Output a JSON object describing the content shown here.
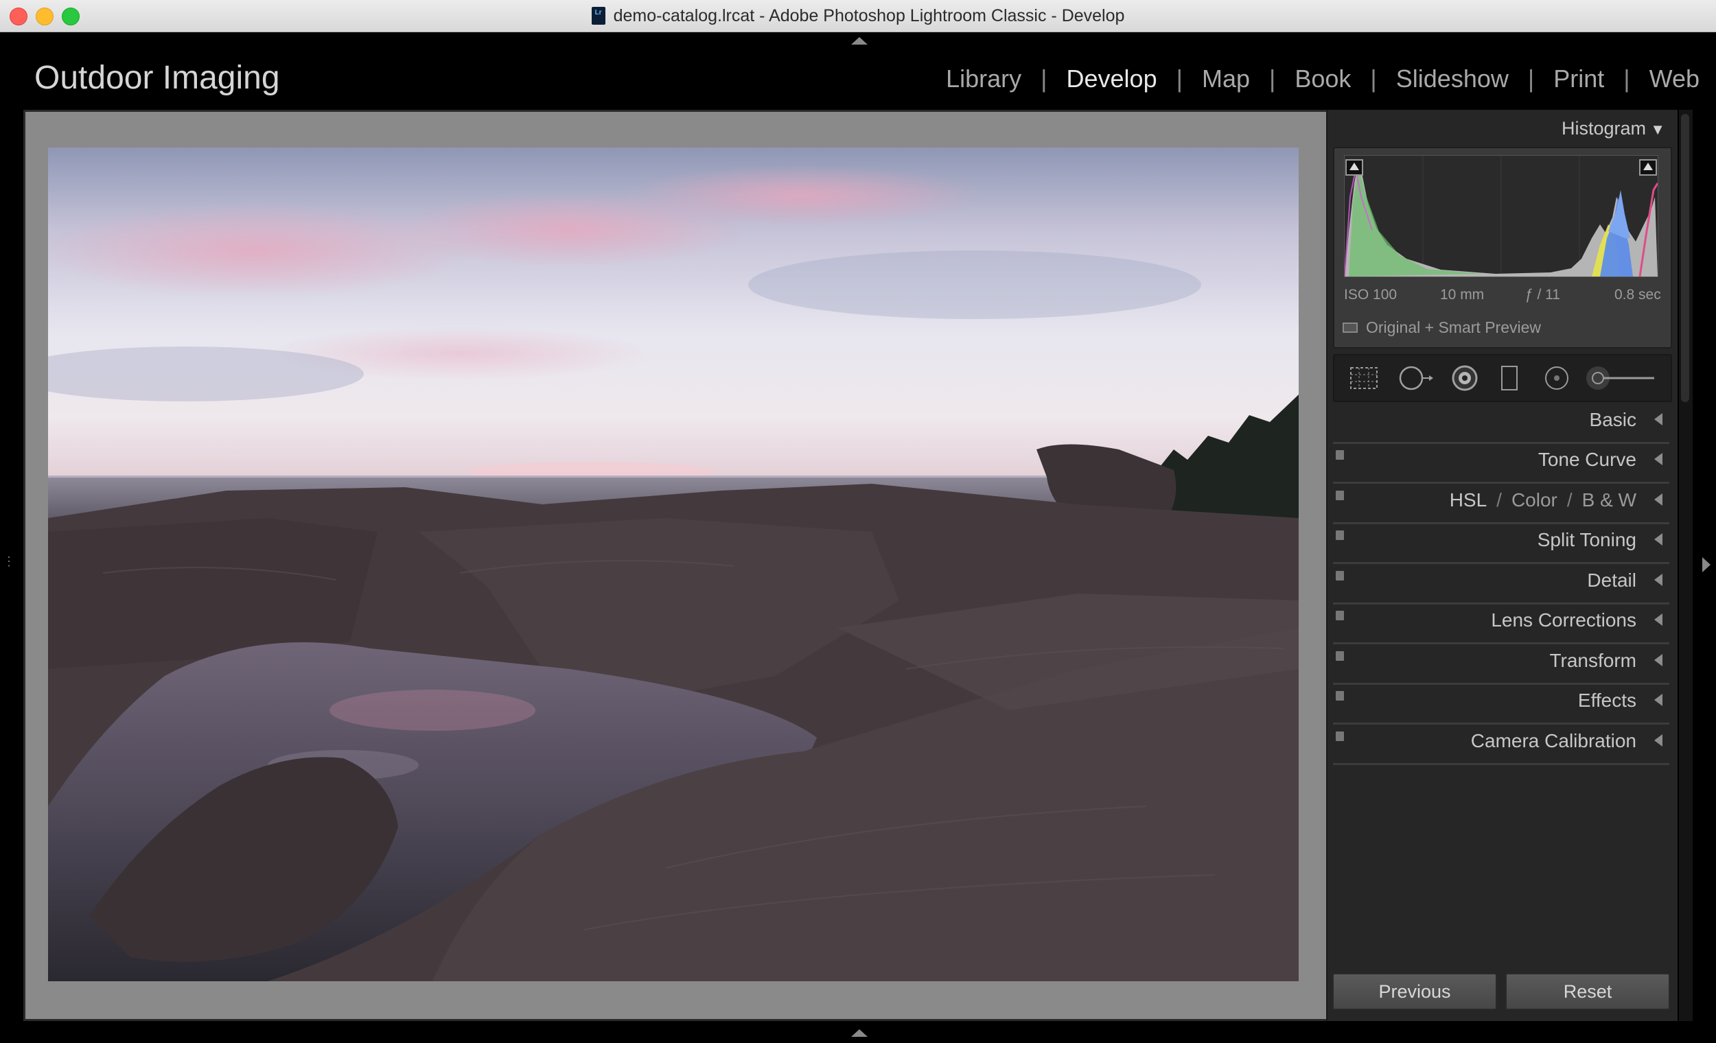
{
  "window": {
    "title": "demo-catalog.lrcat - Adobe Photoshop Lightroom Classic - Develop",
    "doc_icon_label": "Lr"
  },
  "identity_plate": "Outdoor Imaging",
  "modules": [
    {
      "label": "Library",
      "active": false
    },
    {
      "label": "Develop",
      "active": true
    },
    {
      "label": "Map",
      "active": false
    },
    {
      "label": "Book",
      "active": false
    },
    {
      "label": "Slideshow",
      "active": false
    },
    {
      "label": "Print",
      "active": false
    },
    {
      "label": "Web",
      "active": false
    }
  ],
  "module_separator": "|",
  "histogram": {
    "title": "Histogram",
    "iso": "ISO 100",
    "focal": "10 mm",
    "aperture": "ƒ / 11",
    "shutter": "0.8 sec",
    "preview_status": "Original + Smart Preview"
  },
  "tools": [
    "crop-overlay-icon",
    "spot-removal-icon",
    "red-eye-icon",
    "graduated-filter-icon",
    "radial-filter-icon",
    "adjustment-brush-icon"
  ],
  "sections": [
    {
      "label": "Basic",
      "has_toggle": false
    },
    {
      "label": "Tone Curve",
      "has_toggle": true
    },
    {
      "label": "HSL",
      "has_toggle": true
    },
    {
      "label": "Split Toning",
      "has_toggle": true
    },
    {
      "label": "Detail",
      "has_toggle": true
    },
    {
      "label": "Lens Corrections",
      "has_toggle": true
    },
    {
      "label": "Transform",
      "has_toggle": true
    },
    {
      "label": "Effects",
      "has_toggle": true
    },
    {
      "label": "Camera Calibration",
      "has_toggle": true
    }
  ],
  "hsl_parts": {
    "hsl": "HSL",
    "sep": "/",
    "color": "Color",
    "bw": "B & W"
  },
  "buttons": {
    "previous": "Previous",
    "reset": "Reset"
  },
  "colors": {
    "accent_active": "#e8e8e8",
    "panel_bg": "#262626",
    "workspace_bg": "#8a8a8a"
  }
}
